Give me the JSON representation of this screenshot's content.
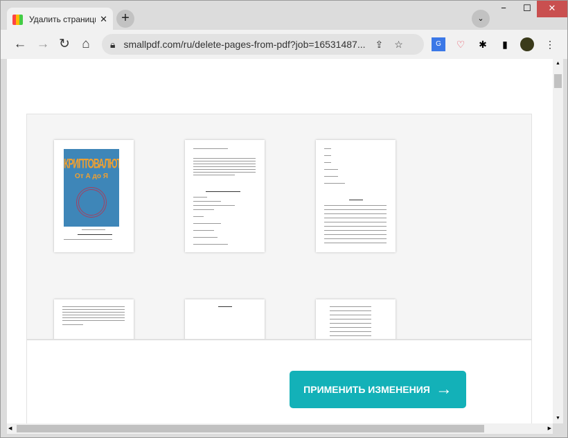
{
  "browser": {
    "tab_title": "Удалить страницы из PDF: удаля",
    "new_tab": "+",
    "url": "smallpdf.com/ru/delete-pages-from-pdf?job=16531487...",
    "window_controls": {
      "minimize": "−",
      "maximize": "☐",
      "close": "✕"
    }
  },
  "pages": {
    "cover_title": "КРИПТОВАЛЮТЫ",
    "cover_subtitle": "От А до Я"
  },
  "footer": {
    "apply_label": "ПРИМЕНИТЬ ИЗМЕНЕНИЯ",
    "apply_arrow": "→"
  },
  "colors": {
    "accent": "#13b1b8"
  }
}
